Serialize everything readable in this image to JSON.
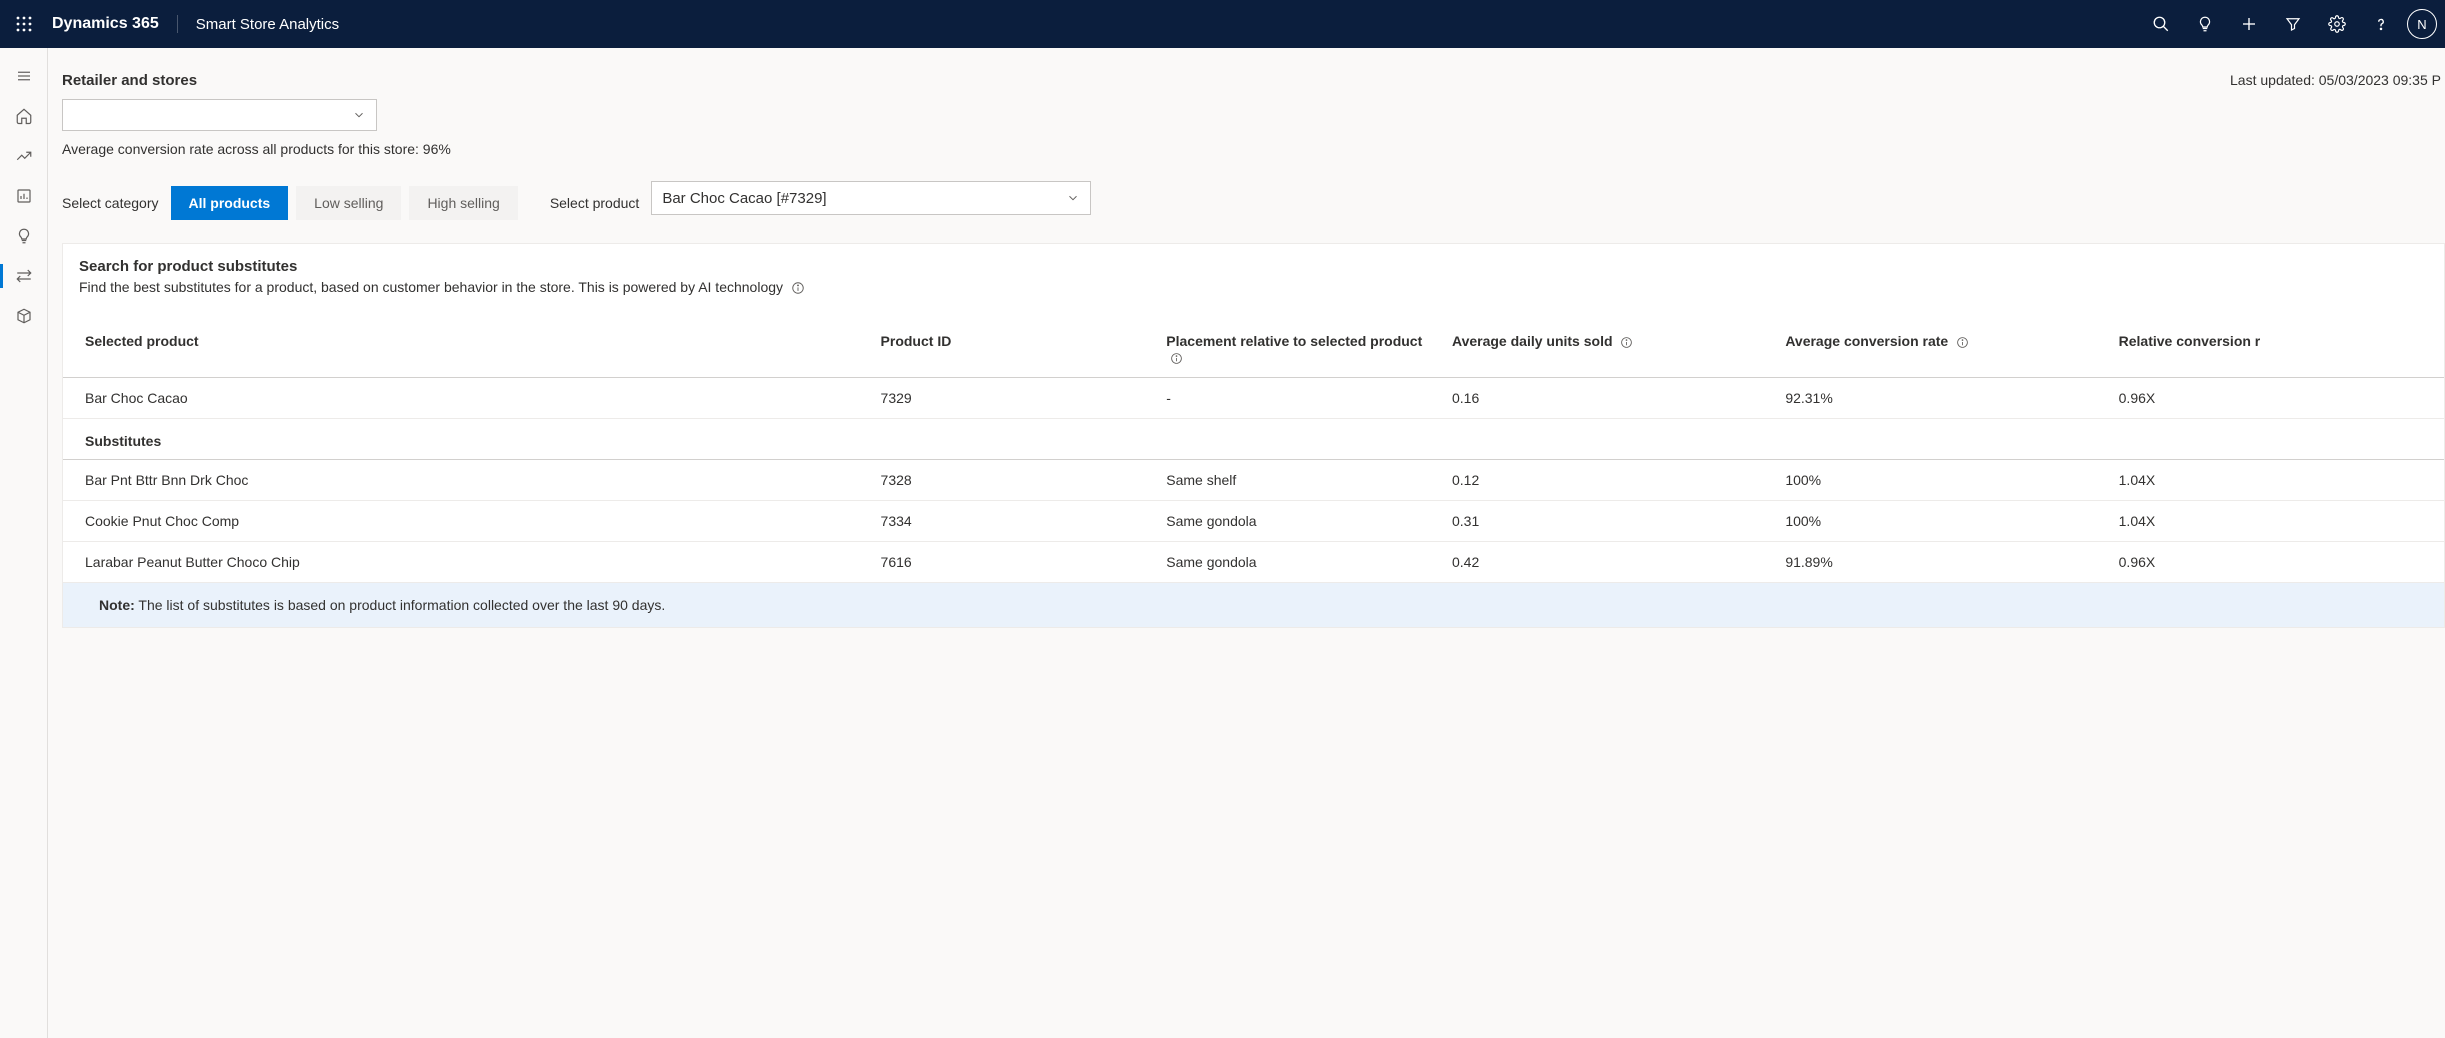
{
  "header": {
    "brand": "Dynamics 365",
    "app_name": "Smart Store Analytics",
    "avatar_initial": "N"
  },
  "page": {
    "retailer_heading": "Retailer and stores",
    "last_updated_label": "Last updated:",
    "last_updated_value": "05/03/2023 09:35 P",
    "conversion_rate_line": "Average conversion rate across all products for this store: 96%",
    "select_category_label": "Select category",
    "filters": {
      "all": "All products",
      "low": "Low selling",
      "high": "High selling"
    },
    "select_product_label": "Select product",
    "selected_product": "Bar Choc Cacao [#7329]"
  },
  "card": {
    "title": "Search for product substitutes",
    "desc": "Find the best substitutes for a product, based on customer behavior in the store. This is powered by AI technology"
  },
  "table": {
    "columns": {
      "selected_product": "Selected product",
      "product_id": "Product ID",
      "placement": "Placement relative to selected product",
      "avg_units": "Average daily units sold",
      "avg_conv": "Average conversion rate",
      "rel_conv": "Relative conversion r"
    },
    "selected_row": {
      "name": "Bar Choc Cacao",
      "id": "7329",
      "placement": "-",
      "units": "0.16",
      "conv": "92.31%",
      "rel": "0.96X"
    },
    "substitutes_label": "Substitutes",
    "substitutes": [
      {
        "name": "Bar Pnt Bttr Bnn Drk Choc",
        "id": "7328",
        "placement": "Same shelf",
        "units": "0.12",
        "conv": "100%",
        "rel": "1.04X"
      },
      {
        "name": "Cookie Pnut Choc Comp",
        "id": "7334",
        "placement": "Same gondola",
        "units": "0.31",
        "conv": "100%",
        "rel": "1.04X"
      },
      {
        "name": "Larabar Peanut Butter Choco Chip",
        "id": "7616",
        "placement": "Same gondola",
        "units": "0.42",
        "conv": "91.89%",
        "rel": "0.96X"
      }
    ],
    "note_label": "Note:",
    "note_text": "The list of substitutes is based on product information collected over the last 90 days."
  }
}
